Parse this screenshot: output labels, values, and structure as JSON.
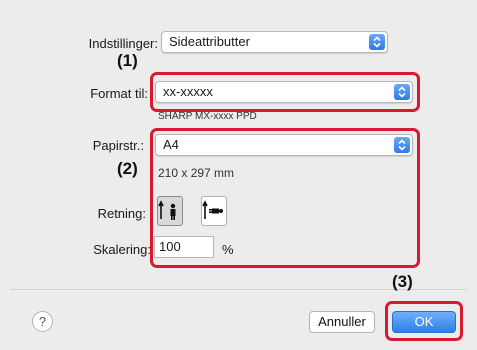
{
  "settings": {
    "label": "Indstillinger:",
    "value": "Sideattributter"
  },
  "format": {
    "label": "Format til:",
    "value": "xx-xxxxx",
    "subtext": "SHARP MX-xxxx PPD"
  },
  "paper": {
    "label": "Papirstr.:",
    "value": "A4",
    "dimensions": "210 x 297 mm"
  },
  "orientation": {
    "label": "Retning:",
    "options": [
      "portrait",
      "landscape"
    ],
    "selected": "portrait"
  },
  "scale": {
    "label": "Skalering:",
    "value": "100",
    "unit": "%"
  },
  "buttons": {
    "help": "?",
    "cancel": "Annuller",
    "ok": "OK"
  },
  "callouts": {
    "c1": "(1)",
    "c2": "(2)",
    "c3": "(3)"
  },
  "colors": {
    "highlight": "#d8192e",
    "accent": "#2d7fe8",
    "background": "#ececec"
  }
}
